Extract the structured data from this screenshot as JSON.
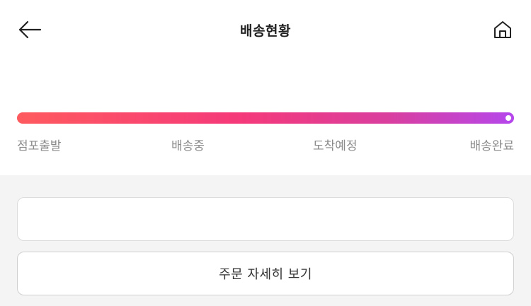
{
  "header": {
    "title": "배송현황",
    "back_icon": "arrow-left-icon",
    "home_icon": "home-icon"
  },
  "progress": {
    "value": 1.0,
    "gradient_start": "#ff5a5f",
    "gradient_end": "#b547ec",
    "steps": [
      "점포출발",
      "배송중",
      "도착예정",
      "배송완료"
    ]
  },
  "actions": {
    "detail_label": "주문 자세히 보기"
  }
}
